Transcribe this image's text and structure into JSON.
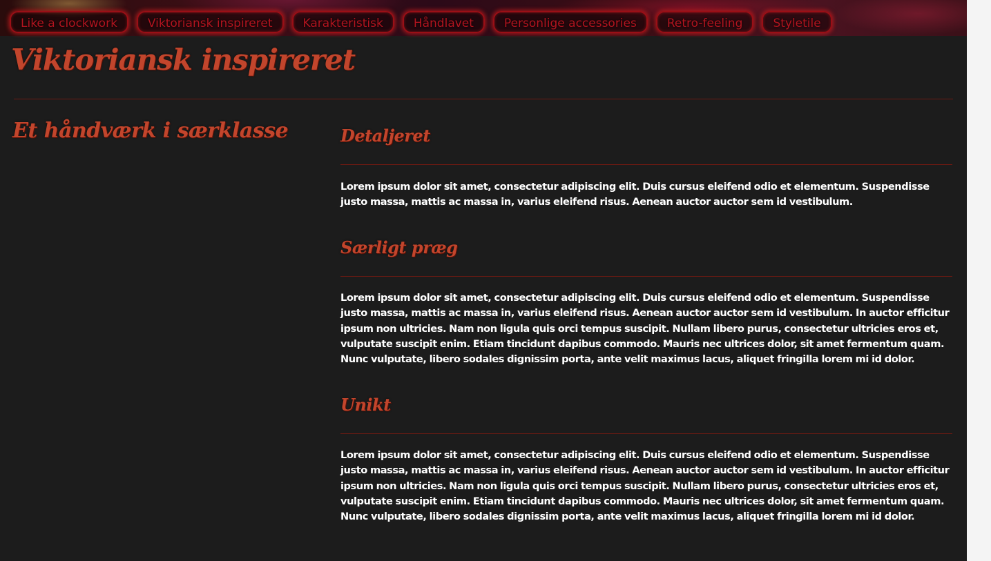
{
  "nav": {
    "items": [
      "Like a clockwork",
      "Viktoriansk inspireret",
      "Karakteristisk",
      "Håndlavet",
      "Personlige accessories",
      "Retro-feeling",
      "Styletile"
    ]
  },
  "page": {
    "title": "Viktoriansk inspireret",
    "subtitle": "Et håndværk i særklasse"
  },
  "sections": [
    {
      "heading": "Detaljeret",
      "text": "Lorem ipsum dolor sit amet, consectetur adipiscing elit. Duis cursus eleifend odio et elementum. Suspendisse justo massa, mattis ac massa in, varius eleifend risus. Aenean auctor auctor sem id vestibulum."
    },
    {
      "heading": "Særligt præg",
      "text": "Lorem ipsum dolor sit amet, consectetur adipiscing elit. Duis cursus eleifend odio et elementum. Suspendisse justo massa, mattis ac massa in, varius eleifend risus. Aenean auctor auctor sem id vestibulum. In auctor efficitur ipsum non ultricies. Nam non ligula quis orci tempus suscipit. Nullam libero purus, consectetur ultricies eros et, vulputate suscipit enim. Etiam tincidunt dapibus commodo. Mauris nec ultrices dolor, sit amet fermentum quam. Nunc vulputate, libero sodales dignissim porta, ante velit maximus lacus, aliquet fringilla lorem mi id dolor."
    },
    {
      "heading": "Unikt",
      "text": "Lorem ipsum dolor sit amet, consectetur adipiscing elit. Duis cursus eleifend odio et elementum. Suspendisse justo massa, mattis ac massa in, varius eleifend risus. Aenean auctor auctor sem id vestibulum. In auctor efficitur ipsum non ultricies. Nam non ligula quis orci tempus suscipit. Nullam libero purus, consectetur ultricies eros et, vulputate suscipit enim. Etiam tincidunt dapibus commodo. Mauris nec ultrices dolor, sit amet fermentum quam. Nunc vulputate, libero sodales dignissim porta, ante velit maximus lacus, aliquet fringilla lorem mi id dolor."
    }
  ],
  "colors": {
    "background": "#1c1c1c",
    "accent": "#c2452c",
    "nav_text": "#b3141f",
    "rule": "#6d1a12",
    "body_text": "#ffffff"
  }
}
